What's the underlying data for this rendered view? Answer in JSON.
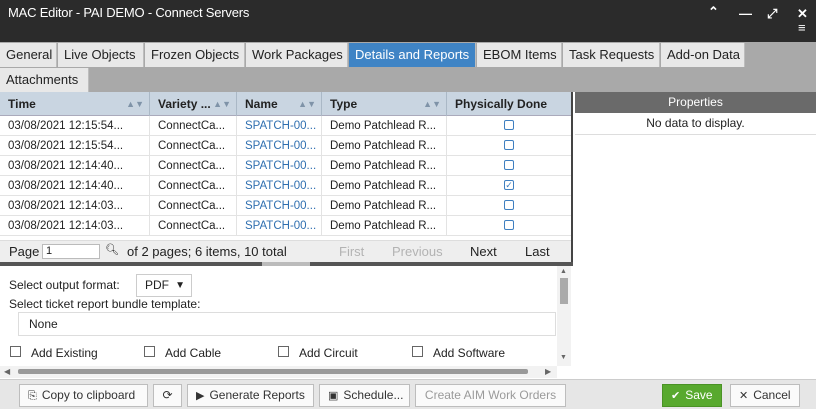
{
  "window": {
    "title": "MAC Editor - PAI DEMO - Connect Servers",
    "controls": {
      "collapse": "⌃",
      "minimize": "—",
      "maximize": "⤢",
      "close": "✕",
      "menu": "≡"
    }
  },
  "tabs": [
    {
      "label": "General"
    },
    {
      "label": "Live Objects"
    },
    {
      "label": "Frozen Objects"
    },
    {
      "label": "Work Packages"
    },
    {
      "label": "Details and Reports",
      "active": true
    },
    {
      "label": "EBOM Items"
    },
    {
      "label": "Task Requests"
    },
    {
      "label": "Add-on Data"
    },
    {
      "label": "Attachments"
    }
  ],
  "grid": {
    "columns": [
      "Time",
      "Variety ...",
      "Name",
      "Type",
      "Physically Done"
    ],
    "rows": [
      {
        "time": "03/08/2021 12:15:54...",
        "variety": "ConnectCa...",
        "name": "SPATCH-00...",
        "type": "Demo Patchlead R...",
        "done": false
      },
      {
        "time": "03/08/2021 12:15:54...",
        "variety": "ConnectCa...",
        "name": "SPATCH-00...",
        "type": "Demo Patchlead R...",
        "done": false
      },
      {
        "time": "03/08/2021 12:14:40...",
        "variety": "ConnectCa...",
        "name": "SPATCH-00...",
        "type": "Demo Patchlead R...",
        "done": false
      },
      {
        "time": "03/08/2021 12:14:40...",
        "variety": "ConnectCa...",
        "name": "SPATCH-00...",
        "type": "Demo Patchlead R...",
        "done": true
      },
      {
        "time": "03/08/2021 12:14:03...",
        "variety": "ConnectCa...",
        "name": "SPATCH-00...",
        "type": "Demo Patchlead R...",
        "done": false
      },
      {
        "time": "03/08/2021 12:14:03...",
        "variety": "ConnectCa...",
        "name": "SPATCH-00...",
        "type": "Demo Patchlead R...",
        "done": false
      }
    ]
  },
  "pager": {
    "page_label": "Page",
    "page_value": "1",
    "summary": "of 2 pages; 6 items, 10 total",
    "first": "First",
    "previous": "Previous",
    "next": "Next",
    "last": "Last"
  },
  "properties": {
    "header": "Properties",
    "empty_text": "No data to display."
  },
  "options": {
    "output_format_label": "Select output format:",
    "output_format_value": "PDF",
    "template_label": "Select ticket report bundle template:",
    "template_value": "None",
    "checkboxes": [
      "Add Existing",
      "Add Cable",
      "Add Circuit",
      "Add Software"
    ]
  },
  "footer": {
    "copy": "Copy to clipboard",
    "generate": "Generate Reports",
    "schedule": "Schedule...",
    "create_aim": "Create AIM Work Orders",
    "save": "Save",
    "cancel": "Cancel"
  },
  "colors": {
    "accent": "#3f84c5",
    "save": "#58a92e",
    "titlebar": "#2b2b2b"
  }
}
